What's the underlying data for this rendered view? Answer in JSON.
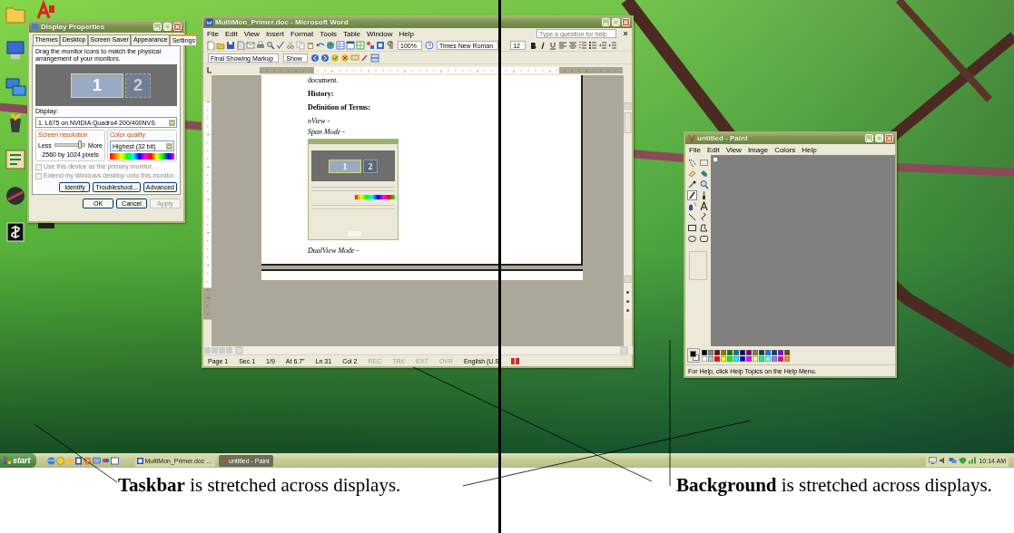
{
  "desktop": {
    "icons": [
      {
        "kind": "folder"
      },
      {
        "kind": "computer"
      },
      {
        "kind": "network"
      },
      {
        "kind": "recycle"
      },
      {
        "kind": "outlook"
      },
      {
        "kind": "disc"
      },
      {
        "kind": "ticker"
      }
    ],
    "second_column": [
      {
        "kind": "acrobat"
      },
      {
        "kind": "app"
      }
    ]
  },
  "display_properties": {
    "title": "Display Properties",
    "tabs": [
      {
        "label": "Themes",
        "selected": false
      },
      {
        "label": "Desktop",
        "selected": false
      },
      {
        "label": "Screen Saver",
        "selected": false
      },
      {
        "label": "Appearance",
        "selected": false
      },
      {
        "label": "Settings",
        "selected": true
      }
    ],
    "instruction": "Drag the monitor icons to match the physical arrangement of your monitors.",
    "monitors": [
      {
        "label": "1",
        "selected": true
      },
      {
        "label": "2",
        "selected": false
      }
    ],
    "display_label": "Display:",
    "display_value": "1. L675 on NVIDIA Quadro4 200/400NVS",
    "resolution": {
      "title": "Screen resolution",
      "less": "Less",
      "more": "More",
      "level": 0.85,
      "reading": "2560 by 1024 pixels"
    },
    "color_quality": {
      "title": "Color quality",
      "value": "Highest (32 bit)"
    },
    "options": [
      {
        "label": "Use this device as the primary monitor.",
        "checked": false,
        "disabled": true
      },
      {
        "label": "Extend my Windows desktop onto this monitor.",
        "checked": false,
        "disabled": true
      }
    ],
    "buttons": [
      {
        "label": "Identify",
        "disabled": false
      },
      {
        "label": "Troubleshoot...",
        "disabled": false
      },
      {
        "label": "Advanced",
        "disabled": false
      }
    ],
    "dialog_buttons": [
      {
        "label": "OK",
        "disabled": false
      },
      {
        "label": "Cancel",
        "disabled": false
      },
      {
        "label": "Apply",
        "disabled": true
      }
    ]
  },
  "word": {
    "title": "MultiMon_Primer.doc - Microsoft Word",
    "menu": [
      "File",
      "Edit",
      "View",
      "Insert",
      "Format",
      "Tools",
      "Table",
      "Window",
      "Help"
    ],
    "help_placeholder": "Type a question for help",
    "zoom": "100%",
    "font": "Times New Roman",
    "size": "12",
    "markup": "Final Showing Markup",
    "show": "Show",
    "document": [
      {
        "kind": "text",
        "text": "document."
      },
      {
        "kind": "heading",
        "text": "History:"
      },
      {
        "kind": "heading",
        "text": "Definition of Terms:"
      },
      {
        "kind": "term",
        "text": "nView -"
      },
      {
        "kind": "term",
        "text": "Span Mode -"
      },
      {
        "kind": "figure",
        "monitors": [
          "1",
          "2"
        ]
      },
      {
        "kind": "term",
        "text": "DualView Mode -"
      }
    ],
    "status": [
      {
        "text": "Page 1",
        "disabled": false
      },
      {
        "text": "Sec 1",
        "disabled": false
      },
      {
        "text": "1/9",
        "disabled": false
      },
      {
        "text": "At 6.7\"",
        "disabled": false
      },
      {
        "text": "Ln 31",
        "disabled": false
      },
      {
        "text": "Col 2",
        "disabled": false
      },
      {
        "text": "REC",
        "disabled": true
      },
      {
        "text": "TRK",
        "disabled": true
      },
      {
        "text": "EXT",
        "disabled": true
      },
      {
        "text": "OVR",
        "disabled": true
      },
      {
        "text": "English (U.S",
        "disabled": false
      }
    ]
  },
  "paint": {
    "title": "untitled - Paint",
    "menu": [
      "File",
      "Edit",
      "View",
      "Image",
      "Colors",
      "Help"
    ],
    "tools": [
      {
        "selected": false
      },
      {
        "selected": false
      },
      {
        "selected": false
      },
      {
        "selected": false
      },
      {
        "selected": false
      },
      {
        "selected": false
      },
      {
        "selected": true
      },
      {
        "selected": false
      },
      {
        "selected": false
      },
      {
        "selected": false
      },
      {
        "selected": false
      },
      {
        "selected": false
      },
      {
        "selected": false
      },
      {
        "selected": false
      },
      {
        "selected": false
      },
      {
        "selected": false
      }
    ],
    "foreground": {
      "color": "#000000"
    },
    "background": {
      "color": "#ffffff"
    },
    "palette": [
      {
        "color": "#000000"
      },
      {
        "color": "#808080"
      },
      {
        "color": "#800000"
      },
      {
        "color": "#808000"
      },
      {
        "color": "#008000"
      },
      {
        "color": "#008080"
      },
      {
        "color": "#000080"
      },
      {
        "color": "#800080"
      },
      {
        "color": "#808040"
      },
      {
        "color": "#004040"
      },
      {
        "color": "#0080ff"
      },
      {
        "color": "#004080"
      },
      {
        "color": "#8000ff"
      },
      {
        "color": "#804000"
      },
      {
        "color": "#ffffff"
      },
      {
        "color": "#c0c0c0"
      },
      {
        "color": "#ff0000"
      },
      {
        "color": "#ffff00"
      },
      {
        "color": "#00ff00"
      },
      {
        "color": "#00ffff"
      },
      {
        "color": "#0000ff"
      },
      {
        "color": "#ff00ff"
      },
      {
        "color": "#ffff80"
      },
      {
        "color": "#00ff80"
      },
      {
        "color": "#80ffff"
      },
      {
        "color": "#8080ff"
      },
      {
        "color": "#ff0080"
      },
      {
        "color": "#ff8040"
      }
    ],
    "status": "For Help, click Help Topics on the Help Menu."
  },
  "taskbar": {
    "start": "start",
    "tasks": [
      {
        "label": "MultiMon_Primer.doc ...",
        "selected": false
      },
      {
        "label": "untitled - Paint",
        "selected": true
      }
    ],
    "clock": "10:14 AM"
  },
  "captions": [
    {
      "text": "**Taskbar** is stretched across displays."
    },
    {
      "text": "**Background** is stretched across displays."
    }
  ]
}
